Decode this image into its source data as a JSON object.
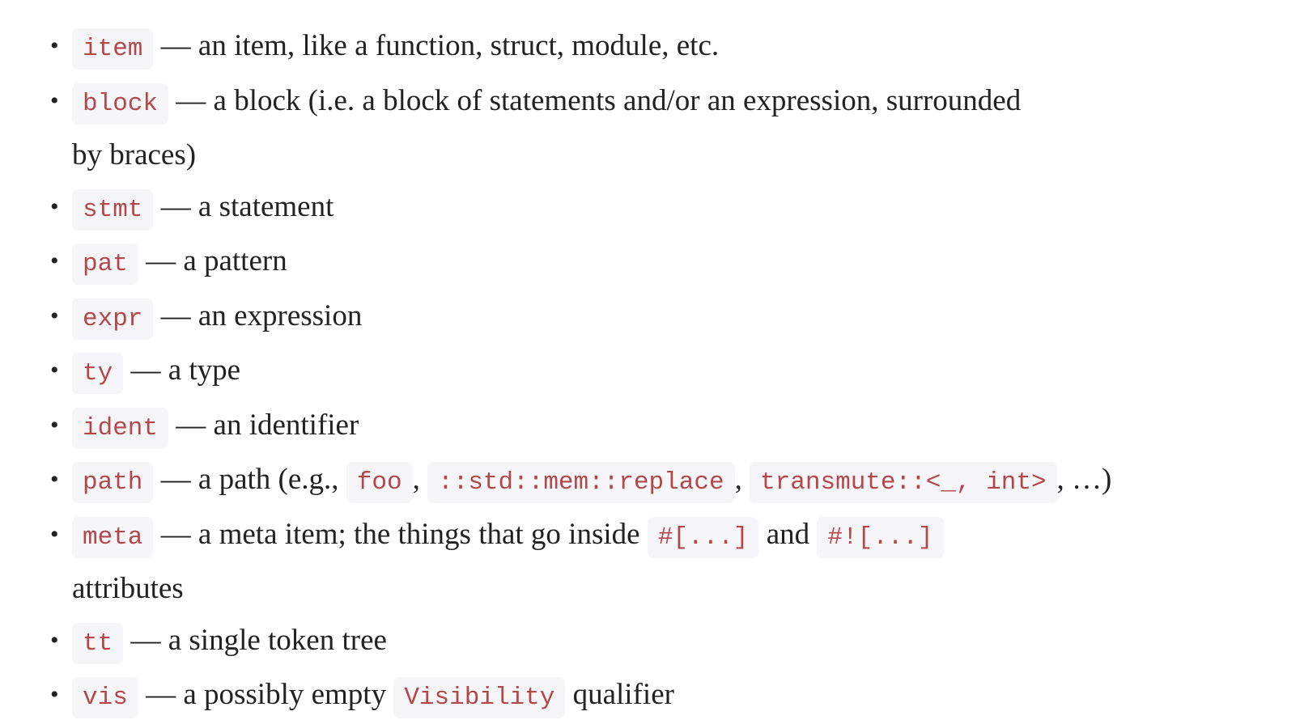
{
  "items": [
    {
      "lines": [
        [
          {
            "code": "item"
          },
          {
            "text": " — an item, like a function, struct, module, etc."
          }
        ]
      ]
    },
    {
      "lines": [
        [
          {
            "code": "block"
          },
          {
            "text": " — a block (i.e. a block of statements and/or an expression, surrounded"
          }
        ],
        [
          {
            "text": "by braces)"
          }
        ]
      ]
    },
    {
      "lines": [
        [
          {
            "code": "stmt"
          },
          {
            "text": " — a statement"
          }
        ]
      ]
    },
    {
      "lines": [
        [
          {
            "code": "pat"
          },
          {
            "text": " — a pattern"
          }
        ]
      ]
    },
    {
      "lines": [
        [
          {
            "code": "expr"
          },
          {
            "text": " — an expression"
          }
        ]
      ]
    },
    {
      "lines": [
        [
          {
            "code": "ty"
          },
          {
            "text": " — a type"
          }
        ]
      ]
    },
    {
      "lines": [
        [
          {
            "code": "ident"
          },
          {
            "text": " — an identifier"
          }
        ]
      ]
    },
    {
      "lines": [
        [
          {
            "code": "path"
          },
          {
            "text": " — a path (e.g., "
          },
          {
            "code": "foo"
          },
          {
            "text": ", "
          },
          {
            "code": "::std::mem::replace"
          },
          {
            "text": ", "
          },
          {
            "code": "transmute::<_, int>"
          },
          {
            "text": ", …)"
          }
        ]
      ]
    },
    {
      "lines": [
        [
          {
            "code": "meta"
          },
          {
            "text": " — a meta item; the things that go inside "
          },
          {
            "code": "#[...]"
          },
          {
            "text": " and "
          },
          {
            "code": "#![...]"
          }
        ],
        [
          {
            "text": "attributes"
          }
        ]
      ]
    },
    {
      "lines": [
        [
          {
            "code": "tt"
          },
          {
            "text": " — a single token tree"
          }
        ]
      ]
    },
    {
      "lines": [
        [
          {
            "code": "vis"
          },
          {
            "text": " — a possibly empty "
          },
          {
            "code": "Visibility"
          },
          {
            "text": " qualifier"
          }
        ]
      ]
    }
  ],
  "colors": {
    "code_text": "#b3474a",
    "code_bg": "#f6f6f8",
    "body_text": "#222222"
  },
  "bullet_icon": "disc"
}
